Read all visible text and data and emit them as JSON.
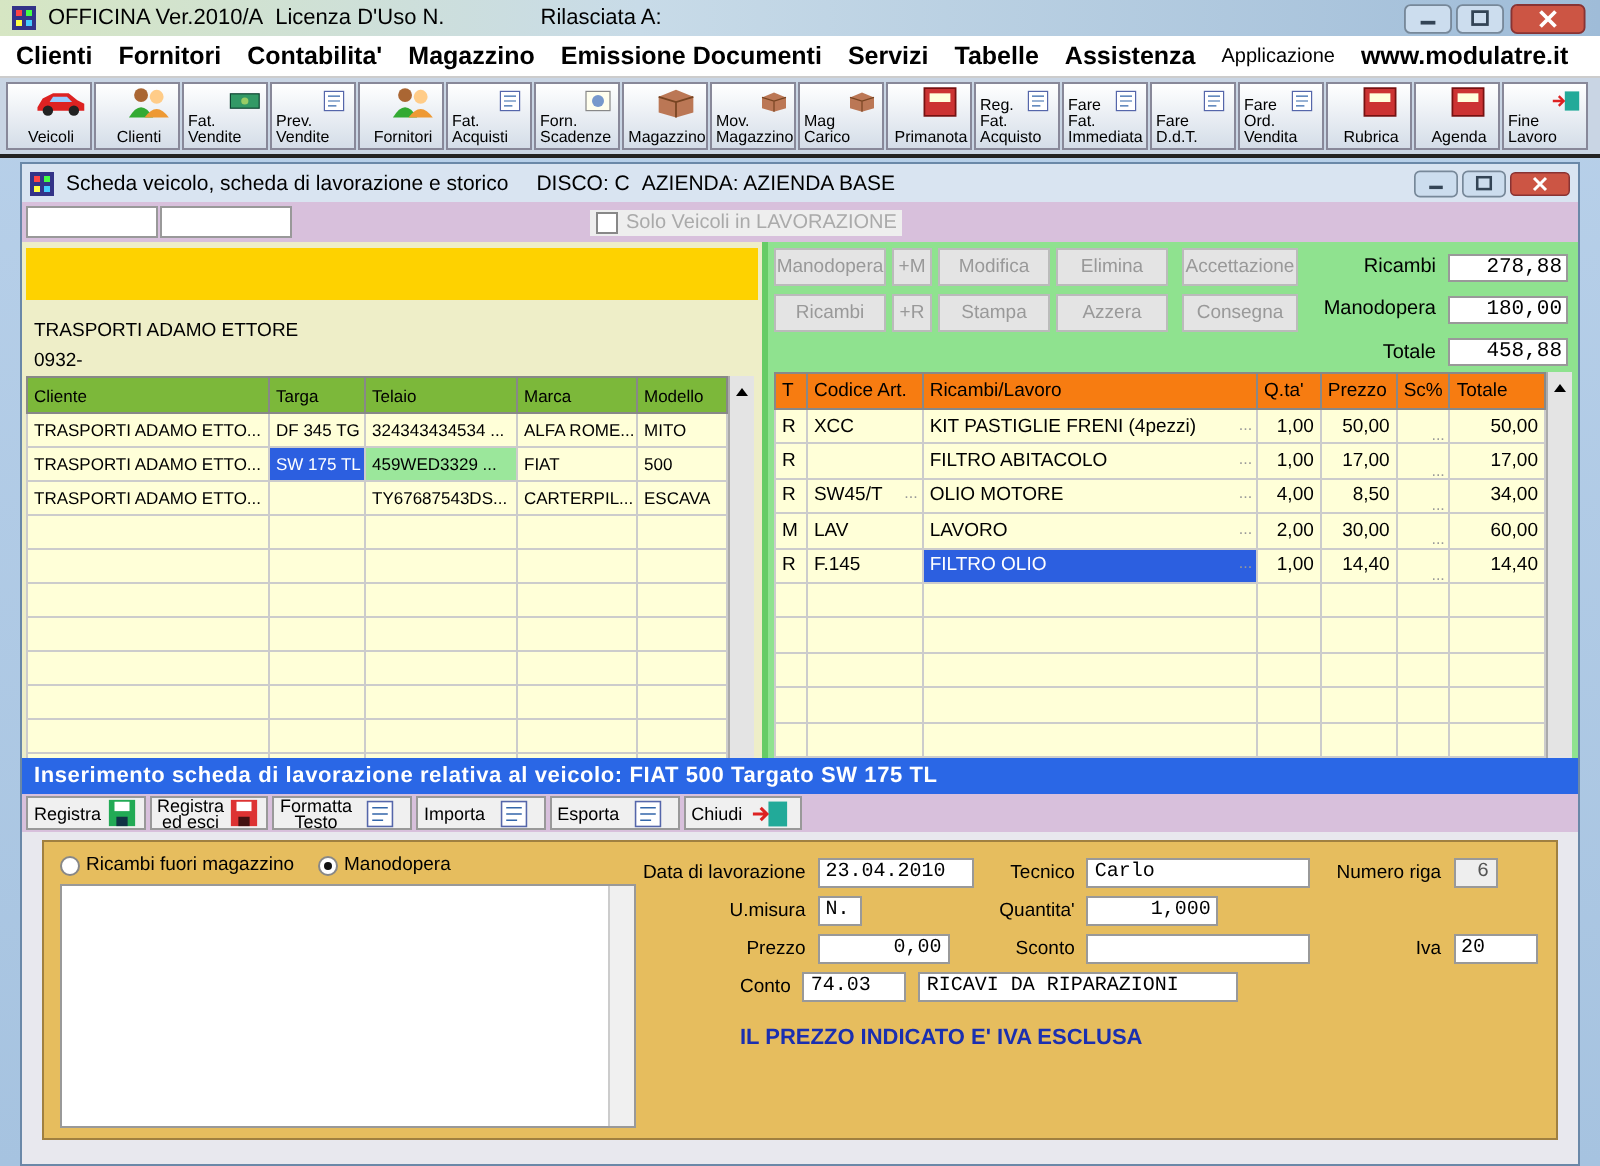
{
  "window": {
    "title": "OFFICINA Ver.2010/A",
    "license": "Licenza D'Uso N.",
    "issued_to": "Rilasciata A:"
  },
  "menu": [
    {
      "label": "Clienti",
      "kind": "menu"
    },
    {
      "label": "Fornitori",
      "kind": "menu"
    },
    {
      "label": "Contabilita'",
      "kind": "menu"
    },
    {
      "label": "Magazzino",
      "kind": "menu"
    },
    {
      "label": "Emissione Documenti",
      "kind": "menu"
    },
    {
      "label": "Servizi",
      "kind": "menu"
    },
    {
      "label": "Tabelle",
      "kind": "menu"
    },
    {
      "label": "Assistenza",
      "kind": "menu"
    },
    {
      "label": "Applicazione",
      "kind": "note"
    },
    {
      "label": "www.modulatre.it",
      "kind": "menu"
    }
  ],
  "toolbar": [
    {
      "label": [
        "Veicoli"
      ]
    },
    {
      "label": [
        "Clienti"
      ]
    },
    {
      "label": [
        "Fat.",
        "Vendite"
      ]
    },
    {
      "label": [
        "Prev.",
        "Vendite"
      ]
    },
    {
      "label": [
        "Fornitori"
      ]
    },
    {
      "label": [
        "Fat.",
        "Acquisti"
      ]
    },
    {
      "label": [
        "Forn.",
        "Scadenze"
      ]
    },
    {
      "label": [
        "Magazzino"
      ]
    },
    {
      "label": [
        "Mov.",
        "Magazzino"
      ]
    },
    {
      "label": [
        "Mag",
        "Carico"
      ]
    },
    {
      "label": [
        "Primanota"
      ]
    },
    {
      "label": [
        "Reg.",
        "Fat.",
        "Acquisto"
      ]
    },
    {
      "label": [
        "Fare",
        "Fat.",
        "Immediata"
      ]
    },
    {
      "label": [
        "Fare",
        "D.d.T."
      ]
    },
    {
      "label": [
        "Fare",
        "Ord.",
        "Vendita"
      ]
    },
    {
      "label": [
        "Rubrica"
      ]
    },
    {
      "label": [
        "Agenda"
      ]
    },
    {
      "label": [
        "Fine",
        "Lavoro"
      ]
    }
  ],
  "child_window": {
    "title": "Scheda veicolo, scheda di lavorazione e storico",
    "disk": "DISCO: C",
    "company": "AZIENDA: AZIENDA BASE"
  },
  "filter": {
    "label": "Solo Veicoli in LAVORAZIONE",
    "checked": false,
    "disabled": true
  },
  "customer": {
    "name": "TRASPORTI ADAMO ETTORE",
    "phone": "0932-"
  },
  "vehicles": {
    "columns": [
      "Cliente",
      "Targa",
      "Telaio",
      "Marca",
      "Modello"
    ],
    "rows": [
      {
        "cells": [
          "TRASPORTI ADAMO ETTO...",
          "DF 345 TG",
          "324343434534 ...",
          "ALFA ROME...",
          "MITO"
        ],
        "selected": false
      },
      {
        "cells": [
          "TRASPORTI ADAMO ETTO...",
          "SW 175 TL",
          "459WED3329 ...",
          "FIAT",
          "500"
        ],
        "selected": true
      },
      {
        "cells": [
          "TRASPORTI ADAMO ETTO...",
          "",
          "TY67687543DS...",
          "CARTERPIL...",
          "ESCAVA"
        ],
        "selected": false
      }
    ]
  },
  "actions": [
    {
      "label": "Manodopera",
      "disabled": true
    },
    {
      "label": "+M",
      "disabled": true
    },
    {
      "label": "Modifica",
      "disabled": true
    },
    {
      "label": "Elimina",
      "disabled": true
    },
    {
      "label": "Accettazione",
      "disabled": true
    },
    {
      "label": "Ricambi",
      "disabled": true
    },
    {
      "label": "+R",
      "disabled": true
    },
    {
      "label": "Stampa",
      "disabled": true
    },
    {
      "label": "Azzera",
      "disabled": true
    },
    {
      "label": "Consegna",
      "disabled": true
    }
  ],
  "totals": [
    {
      "label": "Ricambi",
      "value": "278,88"
    },
    {
      "label": "Manodopera",
      "value": "180,00"
    },
    {
      "label": "Totale",
      "value": "458,88"
    }
  ],
  "items": {
    "columns": [
      "T",
      "Codice Art.",
      "Ricambi/Lavoro",
      "Q.ta'",
      "Prezzo",
      "Sc%",
      "Totale"
    ],
    "rows": [
      {
        "type": "R",
        "code": "XCC",
        "code_more": "",
        "desc": "KIT PASTIGLIE FRENI (4pezzi)",
        "desc_more": "...",
        "qty": "1,00",
        "price": "50,00",
        "discount": "...",
        "total": "50,00",
        "selected": false
      },
      {
        "type": "R",
        "code": "",
        "code_more": "",
        "desc": "FILTRO ABITACOLO",
        "desc_more": "...",
        "qty": "1,00",
        "price": "17,00",
        "discount": "...",
        "total": "17,00",
        "selected": false
      },
      {
        "type": "R",
        "code": "SW45/T",
        "code_more": "...",
        "desc": "OLIO MOTORE",
        "desc_more": "...",
        "qty": "4,00",
        "price": "8,50",
        "discount": "...",
        "total": "34,00",
        "selected": false
      },
      {
        "type": "M",
        "code": "LAV",
        "code_more": "",
        "desc": "LAVORO",
        "desc_more": "...",
        "qty": "2,00",
        "price": "30,00",
        "discount": "...",
        "total": "60,00",
        "selected": false
      },
      {
        "type": "R",
        "code": "F.145",
        "code_more": "",
        "desc": "FILTRO OLIO",
        "desc_more": "...",
        "qty": "1,00",
        "price": "14,40",
        "discount": "...",
        "total": "14,40",
        "selected": true
      }
    ]
  },
  "banner": "Inserimento scheda di lavorazione relativa al veicolo: FIAT  500  Targato SW 175 TL",
  "form_buttons": [
    {
      "label": [
        "Registra"
      ]
    },
    {
      "label": [
        "Registra",
        "ed esci"
      ]
    },
    {
      "label": [
        "Formatta",
        "Testo"
      ]
    },
    {
      "label": [
        "Importa"
      ]
    },
    {
      "label": [
        "Esporta"
      ]
    },
    {
      "label": [
        "Chiudi"
      ]
    }
  ],
  "source": [
    {
      "label": "Ricambi fuori magazzino",
      "selected": false
    },
    {
      "label": "Manodopera",
      "selected": true
    }
  ],
  "fields": {
    "date": {
      "label": "Data di lavorazione",
      "value": "23.04.2010"
    },
    "technician": {
      "label": "Tecnico",
      "value": "Carlo"
    },
    "line_no": {
      "label": "Numero riga",
      "value": "6",
      "disabled": true
    },
    "unit": {
      "label": "U.misura",
      "value": "N."
    },
    "quantity": {
      "label": "Quantita'",
      "value": "1,000"
    },
    "price": {
      "label": "Prezzo",
      "value": "0,00"
    },
    "discount": {
      "label": "Sconto"
    },
    "vat": {
      "label": "Iva",
      "value": "20"
    },
    "account": {
      "label": "Conto",
      "value": "74.03",
      "description": "RICAVI DA RIPARAZIONI"
    }
  },
  "note": "IL PREZZO INDICATO E' IVA ESCLUSA"
}
